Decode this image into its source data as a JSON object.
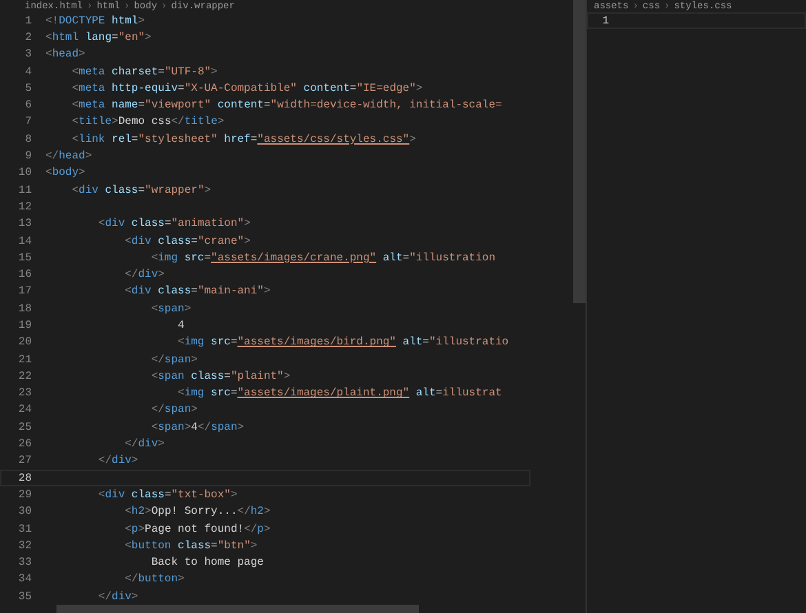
{
  "left_pane": {
    "breadcrumbs": [
      {
        "kind": "crumb",
        "text": "index.html"
      },
      {
        "kind": "separator",
        "text": "›"
      },
      {
        "kind": "crumb",
        "text": "html"
      },
      {
        "kind": "separator",
        "text": "›"
      },
      {
        "kind": "crumb",
        "text": "body"
      },
      {
        "kind": "separator",
        "text": "›"
      },
      {
        "kind": "crumb",
        "text": "div.wrapper"
      }
    ],
    "lines": [
      {
        "number": "1",
        "current": false,
        "tokens": [
          {
            "kind": "punct",
            "text": "<!"
          },
          {
            "kind": "tag",
            "text": "DOCTYPE"
          },
          {
            "kind": "attr",
            "text": " html"
          },
          {
            "kind": "punct",
            "text": ">"
          }
        ]
      },
      {
        "number": "2",
        "current": false,
        "tokens": [
          {
            "kind": "punct",
            "text": "<"
          },
          {
            "kind": "tag",
            "text": "html"
          },
          {
            "kind": "attr",
            "text": " lang"
          },
          {
            "kind": "text",
            "text": "="
          },
          {
            "kind": "string",
            "text": "\"en\""
          },
          {
            "kind": "punct",
            "text": ">"
          }
        ]
      },
      {
        "number": "3",
        "current": false,
        "tokens": [
          {
            "kind": "punct",
            "text": "<"
          },
          {
            "kind": "tag",
            "text": "head"
          },
          {
            "kind": "punct",
            "text": ">"
          }
        ]
      },
      {
        "number": "4",
        "current": false,
        "tokens": [
          {
            "kind": "punct",
            "text": "    <"
          },
          {
            "kind": "tag",
            "text": "meta"
          },
          {
            "kind": "attr",
            "text": " charset"
          },
          {
            "kind": "text",
            "text": "="
          },
          {
            "kind": "string",
            "text": "\"UTF-8\""
          },
          {
            "kind": "punct",
            "text": ">"
          }
        ]
      },
      {
        "number": "5",
        "current": false,
        "tokens": [
          {
            "kind": "punct",
            "text": "    <"
          },
          {
            "kind": "tag",
            "text": "meta"
          },
          {
            "kind": "attr",
            "text": " http-equiv"
          },
          {
            "kind": "text",
            "text": "="
          },
          {
            "kind": "string",
            "text": "\"X-UA-Compatible\""
          },
          {
            "kind": "attr",
            "text": " content"
          },
          {
            "kind": "text",
            "text": "="
          },
          {
            "kind": "string",
            "text": "\"IE=edge\""
          },
          {
            "kind": "punct",
            "text": ">"
          }
        ]
      },
      {
        "number": "6",
        "current": false,
        "tokens": [
          {
            "kind": "punct",
            "text": "    <"
          },
          {
            "kind": "tag",
            "text": "meta"
          },
          {
            "kind": "attr",
            "text": " name"
          },
          {
            "kind": "text",
            "text": "="
          },
          {
            "kind": "string",
            "text": "\"viewport\""
          },
          {
            "kind": "attr",
            "text": " content"
          },
          {
            "kind": "text",
            "text": "="
          },
          {
            "kind": "string",
            "text": "\"width=device-width, initial-scale="
          }
        ]
      },
      {
        "number": "7",
        "current": false,
        "tokens": [
          {
            "kind": "punct",
            "text": "    <"
          },
          {
            "kind": "tag",
            "text": "title"
          },
          {
            "kind": "punct",
            "text": ">"
          },
          {
            "kind": "text",
            "text": "Demo css"
          },
          {
            "kind": "punct",
            "text": "</"
          },
          {
            "kind": "tag",
            "text": "title"
          },
          {
            "kind": "punct",
            "text": ">"
          }
        ]
      },
      {
        "number": "8",
        "current": false,
        "tokens": [
          {
            "kind": "punct",
            "text": "    <"
          },
          {
            "kind": "tag",
            "text": "link"
          },
          {
            "kind": "attr",
            "text": " rel"
          },
          {
            "kind": "text",
            "text": "="
          },
          {
            "kind": "string",
            "text": "\"stylesheet\""
          },
          {
            "kind": "attr",
            "text": " href"
          },
          {
            "kind": "text",
            "text": "="
          },
          {
            "kind": "link",
            "text": "\"assets/css/styles.css\""
          },
          {
            "kind": "punct",
            "text": ">"
          }
        ]
      },
      {
        "number": "9",
        "current": false,
        "tokens": [
          {
            "kind": "punct",
            "text": "</"
          },
          {
            "kind": "tag",
            "text": "head"
          },
          {
            "kind": "punct",
            "text": ">"
          }
        ]
      },
      {
        "number": "10",
        "current": false,
        "tokens": [
          {
            "kind": "punct",
            "text": "<"
          },
          {
            "kind": "tag",
            "text": "body"
          },
          {
            "kind": "punct",
            "text": ">"
          }
        ]
      },
      {
        "number": "11",
        "current": false,
        "tokens": [
          {
            "kind": "punct",
            "text": "    <"
          },
          {
            "kind": "tag",
            "text": "div"
          },
          {
            "kind": "attr",
            "text": " class"
          },
          {
            "kind": "text",
            "text": "="
          },
          {
            "kind": "string",
            "text": "\"wrapper\""
          },
          {
            "kind": "punct",
            "text": ">"
          }
        ]
      },
      {
        "number": "12",
        "current": false
      },
      {
        "number": "13",
        "current": false,
        "tokens": [
          {
            "kind": "punct",
            "text": "        <"
          },
          {
            "kind": "tag",
            "text": "div"
          },
          {
            "kind": "attr",
            "text": " class"
          },
          {
            "kind": "text",
            "text": "="
          },
          {
            "kind": "string",
            "text": "\"animation\""
          },
          {
            "kind": "punct",
            "text": ">"
          }
        ]
      },
      {
        "number": "14",
        "current": false,
        "tokens": [
          {
            "kind": "punct",
            "text": "            <"
          },
          {
            "kind": "tag",
            "text": "div"
          },
          {
            "kind": "attr",
            "text": " class"
          },
          {
            "kind": "text",
            "text": "="
          },
          {
            "kind": "string",
            "text": "\"crane\""
          },
          {
            "kind": "punct",
            "text": ">"
          }
        ]
      },
      {
        "number": "15",
        "current": false,
        "tokens": [
          {
            "kind": "punct",
            "text": "                <"
          },
          {
            "kind": "tag",
            "text": "img"
          },
          {
            "kind": "attr",
            "text": " src"
          },
          {
            "kind": "text",
            "text": "="
          },
          {
            "kind": "link",
            "text": "\"assets/images/crane.png\""
          },
          {
            "kind": "attr",
            "text": " alt"
          },
          {
            "kind": "text",
            "text": "="
          },
          {
            "kind": "string",
            "text": "\"illustration"
          }
        ]
      },
      {
        "number": "16",
        "current": false,
        "tokens": [
          {
            "kind": "punct",
            "text": "            </"
          },
          {
            "kind": "tag",
            "text": "div"
          },
          {
            "kind": "punct",
            "text": ">"
          }
        ]
      },
      {
        "number": "17",
        "current": false,
        "tokens": [
          {
            "kind": "punct",
            "text": "            <"
          },
          {
            "kind": "tag",
            "text": "div"
          },
          {
            "kind": "attr",
            "text": " class"
          },
          {
            "kind": "text",
            "text": "="
          },
          {
            "kind": "string",
            "text": "\"main-ani\""
          },
          {
            "kind": "punct",
            "text": ">"
          }
        ]
      },
      {
        "number": "18",
        "current": false,
        "tokens": [
          {
            "kind": "punct",
            "text": "                <"
          },
          {
            "kind": "tag",
            "text": "span"
          },
          {
            "kind": "punct",
            "text": ">"
          }
        ]
      },
      {
        "number": "19",
        "current": false,
        "tokens": [
          {
            "kind": "text",
            "text": "                    4"
          }
        ]
      },
      {
        "number": "20",
        "current": false,
        "tokens": [
          {
            "kind": "punct",
            "text": "                    <"
          },
          {
            "kind": "tag",
            "text": "img"
          },
          {
            "kind": "attr",
            "text": " src"
          },
          {
            "kind": "text",
            "text": "="
          },
          {
            "kind": "link",
            "text": "\"assets/images/bird.png\""
          },
          {
            "kind": "attr",
            "text": " alt"
          },
          {
            "kind": "text",
            "text": "="
          },
          {
            "kind": "string",
            "text": "\"illustratio"
          }
        ]
      },
      {
        "number": "21",
        "current": false,
        "tokens": [
          {
            "kind": "punct",
            "text": "                </"
          },
          {
            "kind": "tag",
            "text": "span"
          },
          {
            "kind": "punct",
            "text": ">"
          }
        ]
      },
      {
        "number": "22",
        "current": false,
        "tokens": [
          {
            "kind": "punct",
            "text": "                <"
          },
          {
            "kind": "tag",
            "text": "span"
          },
          {
            "kind": "attr",
            "text": " class"
          },
          {
            "kind": "text",
            "text": "="
          },
          {
            "kind": "string",
            "text": "\"plaint\""
          },
          {
            "kind": "punct",
            "text": ">"
          }
        ]
      },
      {
        "number": "23",
        "current": false,
        "tokens": [
          {
            "kind": "punct",
            "text": "                    <"
          },
          {
            "kind": "tag",
            "text": "img"
          },
          {
            "kind": "attr",
            "text": " src"
          },
          {
            "kind": "text",
            "text": "="
          },
          {
            "kind": "link",
            "text": "\"assets/images/plaint.png\""
          },
          {
            "kind": "attr",
            "text": " alt"
          },
          {
            "kind": "text",
            "text": "="
          },
          {
            "kind": "string",
            "text": "illustrat"
          }
        ]
      },
      {
        "number": "24",
        "current": false,
        "tokens": [
          {
            "kind": "punct",
            "text": "                </"
          },
          {
            "kind": "tag",
            "text": "span"
          },
          {
            "kind": "punct",
            "text": ">"
          }
        ]
      },
      {
        "number": "25",
        "current": false,
        "tokens": [
          {
            "kind": "punct",
            "text": "                <"
          },
          {
            "kind": "tag",
            "text": "span"
          },
          {
            "kind": "punct",
            "text": ">"
          },
          {
            "kind": "text",
            "text": "4"
          },
          {
            "kind": "punct",
            "text": "</"
          },
          {
            "kind": "tag",
            "text": "span"
          },
          {
            "kind": "punct",
            "text": ">"
          }
        ]
      },
      {
        "number": "26",
        "current": false,
        "tokens": [
          {
            "kind": "punct",
            "text": "            </"
          },
          {
            "kind": "tag",
            "text": "div"
          },
          {
            "kind": "punct",
            "text": ">"
          }
        ]
      },
      {
        "number": "27",
        "current": false,
        "tokens": [
          {
            "kind": "punct",
            "text": "        </"
          },
          {
            "kind": "tag",
            "text": "div"
          },
          {
            "kind": "punct",
            "text": ">"
          }
        ]
      },
      {
        "number": "28",
        "current": true
      },
      {
        "number": "29",
        "current": false,
        "tokens": [
          {
            "kind": "punct",
            "text": "        <"
          },
          {
            "kind": "tag",
            "text": "div"
          },
          {
            "kind": "attr",
            "text": " class"
          },
          {
            "kind": "text",
            "text": "="
          },
          {
            "kind": "string",
            "text": "\"txt-box\""
          },
          {
            "kind": "punct",
            "text": ">"
          }
        ]
      },
      {
        "number": "30",
        "current": false,
        "tokens": [
          {
            "kind": "punct",
            "text": "            <"
          },
          {
            "kind": "tag",
            "text": "h2"
          },
          {
            "kind": "punct",
            "text": ">"
          },
          {
            "kind": "text",
            "text": "Opp! Sorry..."
          },
          {
            "kind": "punct",
            "text": "</"
          },
          {
            "kind": "tag",
            "text": "h2"
          },
          {
            "kind": "punct",
            "text": ">"
          }
        ]
      },
      {
        "number": "31",
        "current": false,
        "tokens": [
          {
            "kind": "punct",
            "text": "            <"
          },
          {
            "kind": "tag",
            "text": "p"
          },
          {
            "kind": "punct",
            "text": ">"
          },
          {
            "kind": "text",
            "text": "Page not found!"
          },
          {
            "kind": "punct",
            "text": "</"
          },
          {
            "kind": "tag",
            "text": "p"
          },
          {
            "kind": "punct",
            "text": ">"
          }
        ]
      },
      {
        "number": "32",
        "current": false,
        "tokens": [
          {
            "kind": "punct",
            "text": "            <"
          },
          {
            "kind": "tag",
            "text": "button"
          },
          {
            "kind": "attr",
            "text": " class"
          },
          {
            "kind": "text",
            "text": "="
          },
          {
            "kind": "string",
            "text": "\"btn\""
          },
          {
            "kind": "punct",
            "text": ">"
          }
        ]
      },
      {
        "number": "33",
        "current": false,
        "tokens": [
          {
            "kind": "text",
            "text": "                Back to home page"
          }
        ]
      },
      {
        "number": "34",
        "current": false,
        "tokens": [
          {
            "kind": "punct",
            "text": "            </"
          },
          {
            "kind": "tag",
            "text": "button"
          },
          {
            "kind": "punct",
            "text": ">"
          }
        ]
      },
      {
        "number": "35",
        "current": false,
        "tokens": [
          {
            "kind": "punct",
            "text": "        </"
          },
          {
            "kind": "tag",
            "text": "div"
          },
          {
            "kind": "punct",
            "text": ">"
          }
        ]
      }
    ]
  },
  "right_pane": {
    "breadcrumbs": [
      {
        "kind": "crumb",
        "text": "assets"
      },
      {
        "kind": "separator",
        "text": "›"
      },
      {
        "kind": "crumb",
        "text": "css"
      },
      {
        "kind": "separator",
        "text": "›"
      },
      {
        "kind": "crumb",
        "text": "styles.css"
      }
    ],
    "lines": [
      {
        "number": "1",
        "current": true
      }
    ]
  }
}
